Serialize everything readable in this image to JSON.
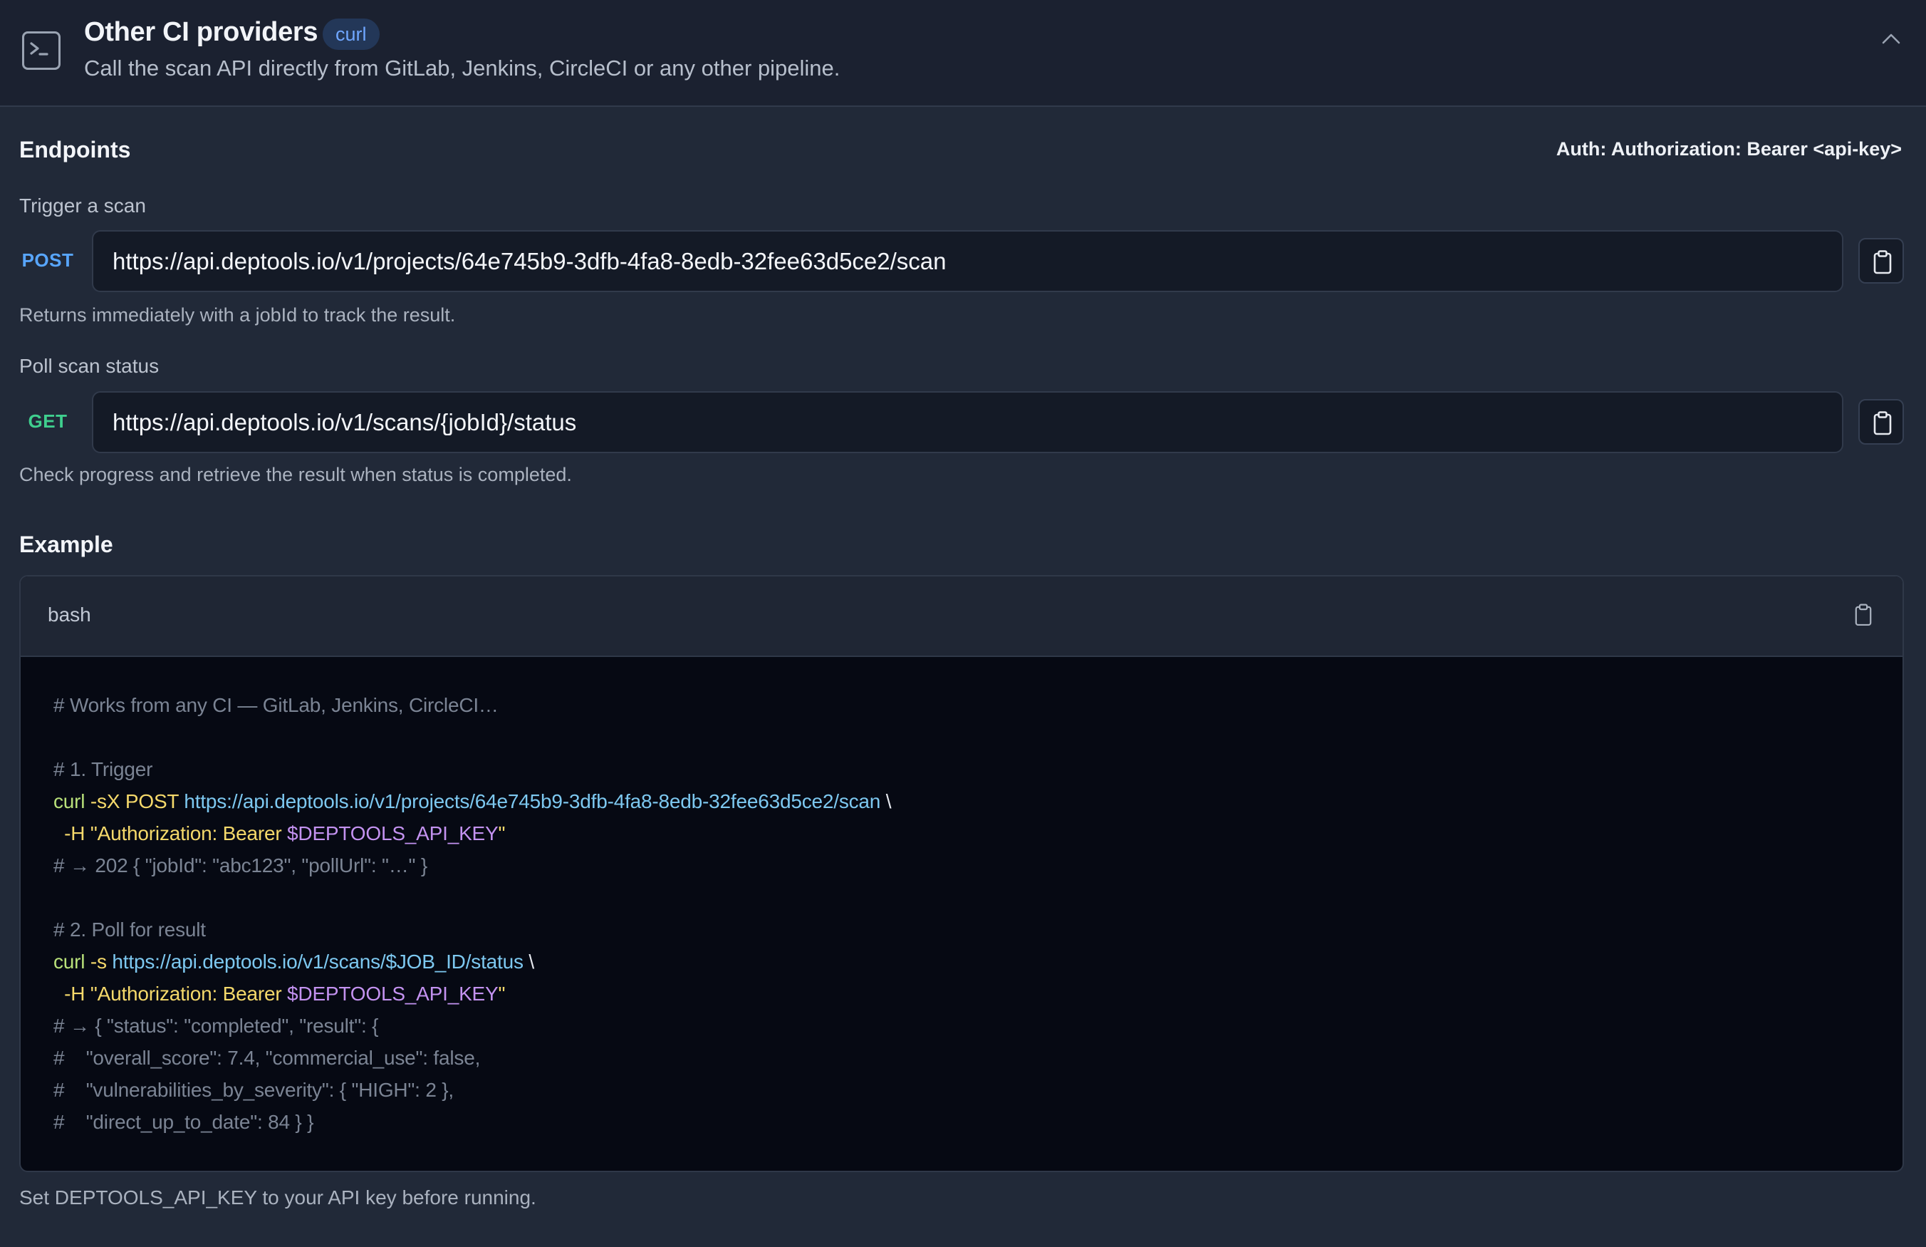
{
  "header": {
    "title": "Other CI providers",
    "badge": "curl",
    "subtitle": "Call the scan API directly from GitLab, Jenkins, CircleCI or any other pipeline."
  },
  "endpoints": {
    "heading": "Endpoints",
    "auth": "Auth: Authorization: Bearer <api-key>",
    "trigger": {
      "label": "Trigger a scan",
      "method": "POST",
      "url": "https://api.deptools.io/v1/projects/64e745b9-3dfb-4fa8-8edb-32fee63d5ce2/scan",
      "hint": "Returns immediately with a jobId to track the result."
    },
    "poll": {
      "label": "Poll scan status",
      "method": "GET",
      "url": "https://api.deptools.io/v1/scans/{jobId}/status",
      "hint": "Check progress and retrieve the result when status is completed."
    }
  },
  "example": {
    "heading": "Example",
    "language": "bash",
    "lines": [
      [
        {
          "t": "# Works from any CI — GitLab, Jenkins, CircleCI…",
          "c": "comment"
        }
      ],
      [],
      [
        {
          "t": "# 1. Trigger",
          "c": "comment"
        }
      ],
      [
        {
          "t": "curl",
          "c": "cmd"
        },
        {
          "t": " -sX POST ",
          "c": "flag"
        },
        {
          "t": "https://api.deptools.io/v1/projects/64e745b9-3dfb-4fa8-8edb-32fee63d5ce2/scan",
          "c": "url"
        },
        {
          "t": " \\",
          "c": "plain"
        }
      ],
      [
        {
          "t": "  -H ",
          "c": "flag"
        },
        {
          "t": "\"Authorization: Bearer ",
          "c": "str"
        },
        {
          "t": "$DEPTOOLS_API_KEY",
          "c": "var"
        },
        {
          "t": "\"",
          "c": "str"
        }
      ],
      [
        {
          "t": "# → 202 { \"jobId\": \"abc123\", \"pollUrl\": \"…\" }",
          "c": "comment"
        }
      ],
      [],
      [
        {
          "t": "# 2. Poll for result",
          "c": "comment"
        }
      ],
      [
        {
          "t": "curl",
          "c": "cmd"
        },
        {
          "t": " -s ",
          "c": "flag"
        },
        {
          "t": "https://api.deptools.io/v1/scans/$JOB_ID/status",
          "c": "url"
        },
        {
          "t": " \\",
          "c": "plain"
        }
      ],
      [
        {
          "t": "  -H ",
          "c": "flag"
        },
        {
          "t": "\"Authorization: Bearer ",
          "c": "str"
        },
        {
          "t": "$DEPTOOLS_API_KEY",
          "c": "var"
        },
        {
          "t": "\"",
          "c": "str"
        }
      ],
      [
        {
          "t": "# → { \"status\": \"completed\", \"result\": {",
          "c": "comment"
        }
      ],
      [
        {
          "t": "#    \"overall_score\": 7.4, \"commercial_use\": false,",
          "c": "comment"
        }
      ],
      [
        {
          "t": "#    \"vulnerabilities_by_severity\": { \"HIGH\": 2 },",
          "c": "comment"
        }
      ],
      [
        {
          "t": "#    \"direct_up_to_date\": 84 } }",
          "c": "comment"
        }
      ]
    ]
  },
  "footer_note": "Set DEPTOOLS_API_KEY to your API key before running.",
  "icons": {
    "header": "terminal-icon",
    "collapse": "chevron-up-icon",
    "copy": "clipboard-icon"
  },
  "colors": {
    "background": "#212938",
    "header_bg": "#1b2130",
    "badge_bg": "#233758",
    "badge_text": "#6fa6ff",
    "post": "#58a6ff",
    "get": "#3fcf8e",
    "code_bg": "#060913"
  }
}
